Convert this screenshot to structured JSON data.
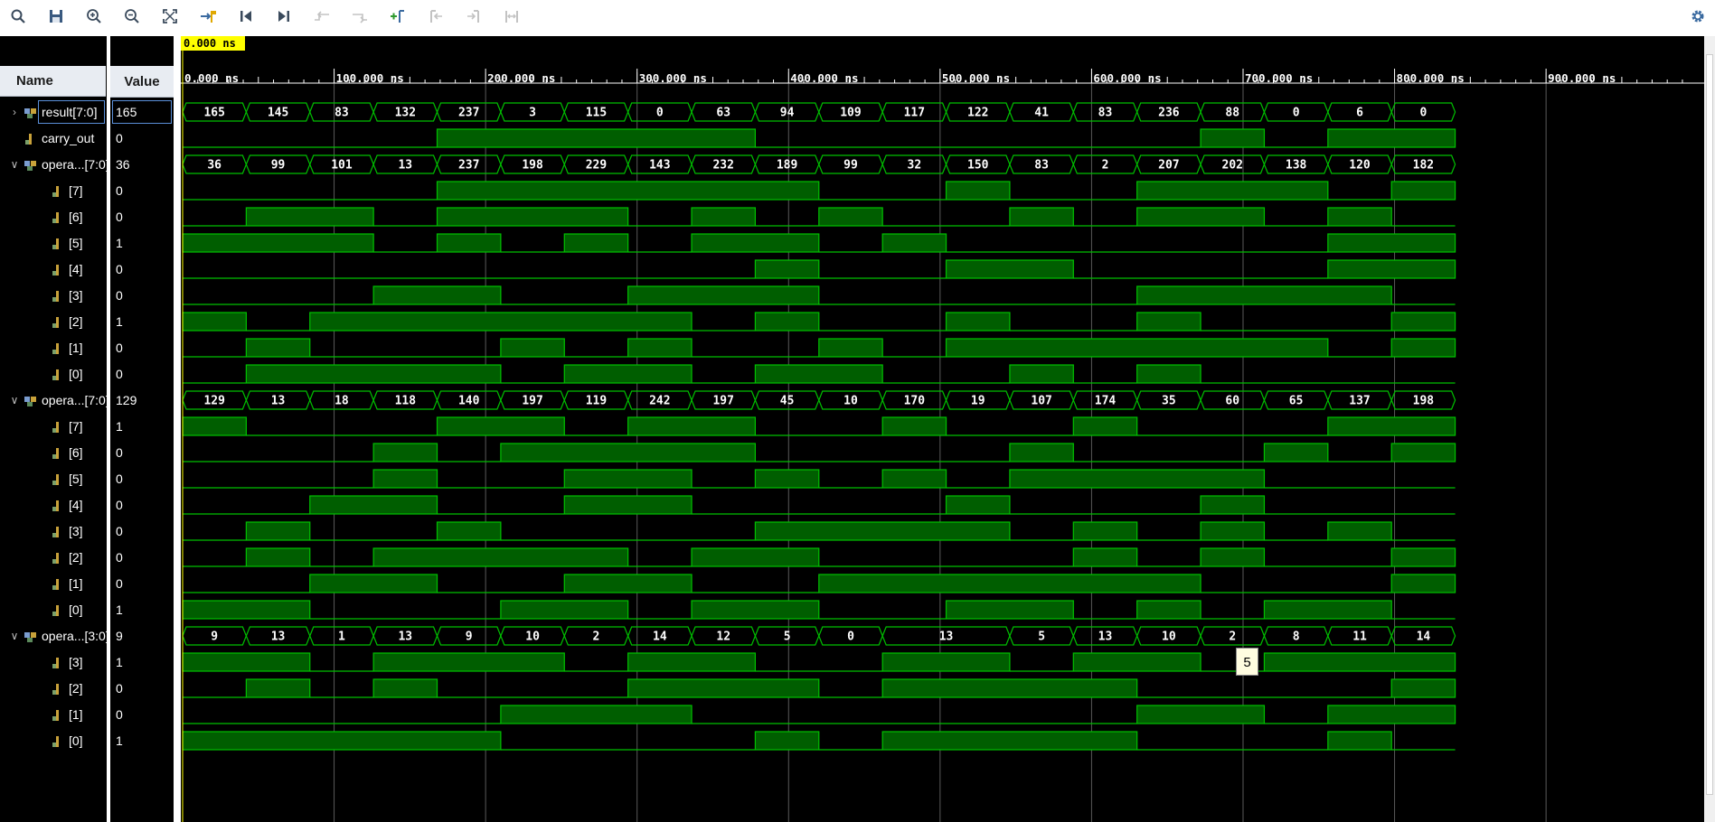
{
  "toolbar": {
    "buttons": [
      {
        "name": "search-icon",
        "enabled": true
      },
      {
        "name": "save-icon",
        "enabled": true
      },
      {
        "name": "zoom-in-icon",
        "enabled": true
      },
      {
        "name": "zoom-out-icon",
        "enabled": true
      },
      {
        "name": "zoom-fit-icon",
        "enabled": true
      },
      {
        "name": "go-to-cursor-icon",
        "enabled": true
      },
      {
        "name": "go-to-time-zero-icon",
        "enabled": true
      },
      {
        "name": "go-to-last-time-icon",
        "enabled": true
      },
      {
        "name": "previous-transition-icon",
        "enabled": false
      },
      {
        "name": "next-transition-icon",
        "enabled": false
      },
      {
        "name": "add-marker-icon",
        "enabled": true
      },
      {
        "name": "previous-marker-icon",
        "enabled": false
      },
      {
        "name": "next-marker-icon",
        "enabled": false
      },
      {
        "name": "swap-cursors-icon",
        "enabled": false
      }
    ],
    "settings_icon": "gear-icon"
  },
  "headers": {
    "name": "Name",
    "value": "Value"
  },
  "cursor_time": "0.000 ns",
  "tooltip_text": "5",
  "timeline": {
    "unit": "ns",
    "range_ns": [
      0,
      1012
    ],
    "major_labels": [
      "0.000 ns",
      "100.000 ns",
      "200.000 ns",
      "300.000 ns",
      "400.000 ns",
      "500.000 ns",
      "600.000 ns",
      "700.000 ns",
      "800.000 ns",
      "900.000 ns"
    ],
    "major_times": [
      0,
      100,
      200,
      300,
      400,
      500,
      600,
      700,
      800,
      900
    ]
  },
  "colors": {
    "wave": "#00c000",
    "wave_fill": "#005e00",
    "grid": "#5a5a5a",
    "cursor_label": "#ffff00"
  },
  "signals": [
    {
      "label": "result[7:0]",
      "value": "165",
      "type": "bus",
      "expandable": true,
      "expanded": false,
      "indent": 0,
      "selected": true,
      "segments": [
        165,
        145,
        83,
        132,
        237,
        3,
        115,
        0,
        63,
        94,
        109,
        117,
        122,
        41,
        83,
        236,
        88,
        0,
        6,
        0
      ]
    },
    {
      "label": "carry_out",
      "value": "0",
      "type": "bit",
      "indent": 0,
      "bits": [
        0,
        0,
        0,
        0,
        1,
        1,
        1,
        1,
        1,
        0,
        0,
        0,
        0,
        0,
        0,
        0,
        1,
        0,
        1,
        1
      ]
    },
    {
      "label": "opera...[7:0]",
      "value": "36",
      "type": "bus",
      "expandable": true,
      "expanded": true,
      "indent": 0,
      "segments": [
        36,
        99,
        101,
        13,
        237,
        198,
        229,
        143,
        232,
        189,
        99,
        32,
        150,
        83,
        2,
        207,
        202,
        138,
        120,
        182
      ]
    },
    {
      "label": "[7]",
      "value": "0",
      "type": "bit",
      "indent": 1,
      "bits": [
        0,
        0,
        0,
        0,
        1,
        1,
        1,
        1,
        1,
        1,
        0,
        0,
        1,
        0,
        0,
        1,
        1,
        1,
        0,
        1
      ]
    },
    {
      "label": "[6]",
      "value": "0",
      "type": "bit",
      "indent": 1,
      "bits": [
        0,
        1,
        1,
        0,
        1,
        1,
        1,
        0,
        1,
        0,
        1,
        0,
        0,
        1,
        0,
        1,
        1,
        0,
        1,
        0
      ]
    },
    {
      "label": "[5]",
      "value": "1",
      "type": "bit",
      "indent": 1,
      "bits": [
        1,
        1,
        1,
        0,
        1,
        0,
        1,
        0,
        1,
        1,
        0,
        1,
        0,
        0,
        0,
        0,
        0,
        0,
        1,
        1
      ]
    },
    {
      "label": "[4]",
      "value": "0",
      "type": "bit",
      "indent": 1,
      "bits": [
        0,
        0,
        0,
        0,
        0,
        0,
        0,
        0,
        0,
        1,
        0,
        0,
        1,
        1,
        0,
        0,
        0,
        0,
        1,
        1
      ]
    },
    {
      "label": "[3]",
      "value": "0",
      "type": "bit",
      "indent": 1,
      "bits": [
        0,
        0,
        0,
        1,
        1,
        0,
        0,
        1,
        1,
        1,
        0,
        0,
        0,
        0,
        0,
        1,
        1,
        1,
        1,
        0
      ]
    },
    {
      "label": "[2]",
      "value": "1",
      "type": "bit",
      "indent": 1,
      "bits": [
        1,
        0,
        1,
        1,
        1,
        1,
        1,
        1,
        0,
        1,
        0,
        0,
        1,
        0,
        0,
        1,
        0,
        0,
        0,
        1
      ]
    },
    {
      "label": "[1]",
      "value": "0",
      "type": "bit",
      "indent": 1,
      "bits": [
        0,
        1,
        0,
        0,
        0,
        1,
        0,
        1,
        0,
        0,
        1,
        0,
        1,
        1,
        1,
        1,
        1,
        1,
        0,
        1
      ]
    },
    {
      "label": "[0]",
      "value": "0",
      "type": "bit",
      "indent": 1,
      "bits": [
        0,
        1,
        1,
        1,
        1,
        0,
        1,
        1,
        0,
        1,
        1,
        0,
        0,
        1,
        0,
        1,
        0,
        0,
        0,
        0
      ]
    },
    {
      "label": "opera...[7:0]",
      "value": "129",
      "type": "bus",
      "expandable": true,
      "expanded": true,
      "indent": 0,
      "segments": [
        129,
        13,
        18,
        118,
        140,
        197,
        119,
        242,
        197,
        45,
        10,
        170,
        19,
        107,
        174,
        35,
        60,
        65,
        137,
        198
      ]
    },
    {
      "label": "[7]",
      "value": "1",
      "type": "bit",
      "indent": 1,
      "bits": [
        1,
        0,
        0,
        0,
        1,
        1,
        0,
        1,
        1,
        0,
        0,
        1,
        0,
        0,
        1,
        0,
        0,
        0,
        1,
        1
      ]
    },
    {
      "label": "[6]",
      "value": "0",
      "type": "bit",
      "indent": 1,
      "bits": [
        0,
        0,
        0,
        1,
        0,
        1,
        1,
        1,
        1,
        0,
        0,
        0,
        0,
        1,
        0,
        0,
        0,
        1,
        0,
        1
      ]
    },
    {
      "label": "[5]",
      "value": "0",
      "type": "bit",
      "indent": 1,
      "bits": [
        0,
        0,
        0,
        1,
        0,
        0,
        1,
        1,
        0,
        1,
        0,
        1,
        0,
        1,
        1,
        1,
        1,
        0,
        0,
        0
      ]
    },
    {
      "label": "[4]",
      "value": "0",
      "type": "bit",
      "indent": 1,
      "bits": [
        0,
        0,
        1,
        1,
        0,
        0,
        1,
        1,
        0,
        0,
        0,
        0,
        1,
        0,
        0,
        0,
        1,
        0,
        0,
        0
      ]
    },
    {
      "label": "[3]",
      "value": "0",
      "type": "bit",
      "indent": 1,
      "bits": [
        0,
        1,
        0,
        0,
        1,
        0,
        0,
        0,
        0,
        1,
        1,
        1,
        1,
        0,
        1,
        0,
        1,
        0,
        1,
        0
      ]
    },
    {
      "label": "[2]",
      "value": "0",
      "type": "bit",
      "indent": 1,
      "bits": [
        0,
        1,
        0,
        1,
        1,
        1,
        1,
        0,
        1,
        1,
        0,
        0,
        0,
        0,
        1,
        0,
        1,
        0,
        0,
        1
      ]
    },
    {
      "label": "[1]",
      "value": "0",
      "type": "bit",
      "indent": 1,
      "bits": [
        0,
        0,
        1,
        1,
        0,
        0,
        1,
        1,
        0,
        0,
        1,
        1,
        1,
        1,
        1,
        1,
        0,
        0,
        0,
        1
      ]
    },
    {
      "label": "[0]",
      "value": "1",
      "type": "bit",
      "indent": 1,
      "bits": [
        1,
        1,
        0,
        0,
        0,
        1,
        1,
        0,
        1,
        1,
        0,
        0,
        1,
        1,
        0,
        1,
        0,
        1,
        1,
        0
      ]
    },
    {
      "label": "opera...[3:0]",
      "value": "9",
      "type": "bus",
      "expandable": true,
      "expanded": true,
      "indent": 0,
      "segments": [
        9,
        13,
        1,
        13,
        9,
        10,
        2,
        14,
        12,
        5,
        0,
        13,
        13,
        5,
        13,
        10,
        2,
        8,
        11,
        14
      ]
    },
    {
      "label": "[3]",
      "value": "1",
      "type": "bit",
      "indent": 1,
      "bits": [
        1,
        1,
        0,
        1,
        1,
        1,
        0,
        1,
        1,
        0,
        0,
        1,
        1,
        0,
        1,
        1,
        0,
        1,
        1,
        1
      ]
    },
    {
      "label": "[2]",
      "value": "0",
      "type": "bit",
      "indent": 1,
      "bits": [
        0,
        1,
        0,
        1,
        0,
        0,
        0,
        1,
        1,
        1,
        0,
        1,
        1,
        1,
        1,
        0,
        0,
        0,
        0,
        1
      ]
    },
    {
      "label": "[1]",
      "value": "0",
      "type": "bit",
      "indent": 1,
      "bits": [
        0,
        0,
        0,
        0,
        0,
        1,
        1,
        1,
        0,
        0,
        0,
        0,
        0,
        0,
        0,
        1,
        1,
        0,
        1,
        1
      ]
    },
    {
      "label": "[0]",
      "value": "1",
      "type": "bit",
      "indent": 1,
      "bits": [
        1,
        1,
        1,
        1,
        1,
        0,
        0,
        0,
        0,
        1,
        0,
        1,
        1,
        1,
        1,
        0,
        0,
        0,
        1,
        0
      ]
    }
  ]
}
